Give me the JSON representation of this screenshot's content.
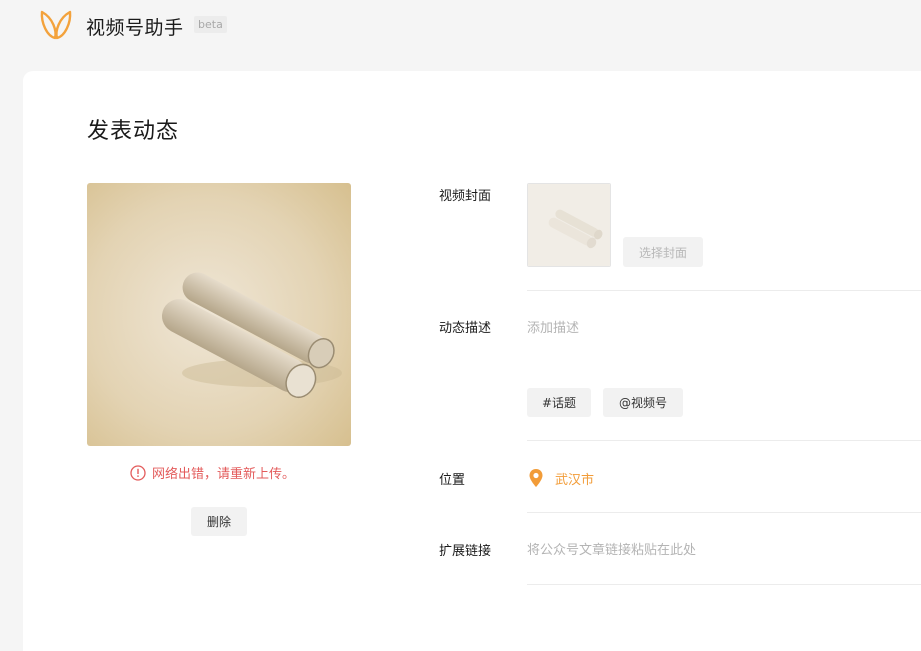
{
  "header": {
    "app_title": "视频号助手",
    "beta_label": "beta",
    "logo_icon": "butterfly-logo-icon"
  },
  "page": {
    "title": "发表动态"
  },
  "preview": {
    "error_text": "网络出错，请重新上传。",
    "error_icon": "alert-circle-icon",
    "delete_label": "删除"
  },
  "form": {
    "cover": {
      "label": "视频封面",
      "choose_label": "选择封面"
    },
    "description": {
      "label": "动态描述",
      "placeholder": "添加描述",
      "value": "",
      "topic_label": "#话题",
      "mention_label": "@视频号"
    },
    "location": {
      "label": "位置",
      "value": "武汉市",
      "icon": "location-pin-icon"
    },
    "extension_link": {
      "label": "扩展链接",
      "placeholder": "将公众号文章链接粘贴在此处",
      "value": ""
    }
  },
  "colors": {
    "accent_orange": "#f29c38",
    "error_red": "#e35b5b",
    "page_bg": "#f5f5f5",
    "card_bg": "#ffffff"
  }
}
